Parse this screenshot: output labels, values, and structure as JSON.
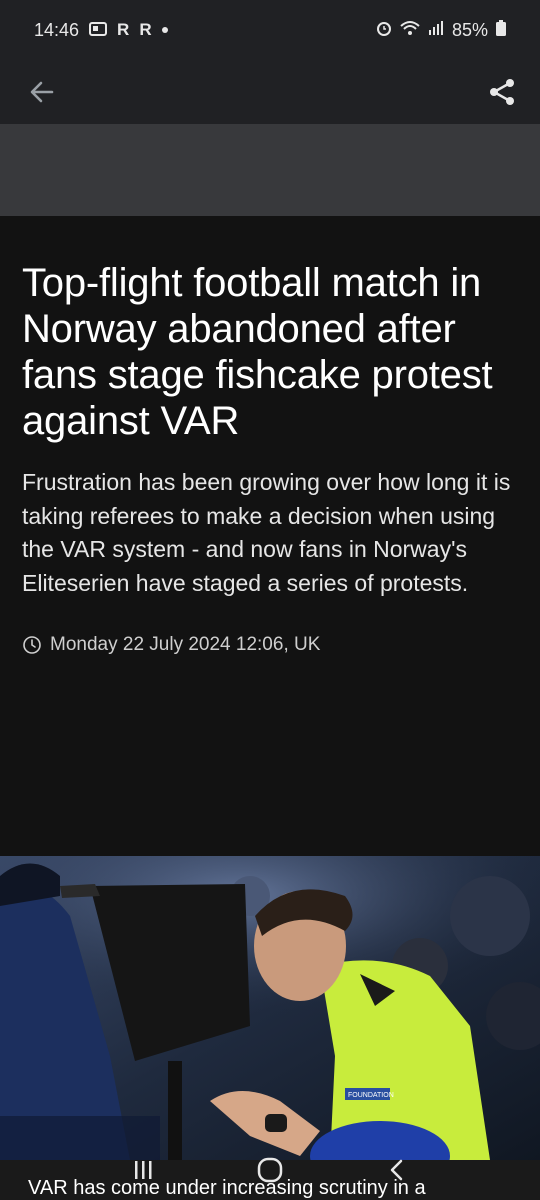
{
  "status": {
    "time": "14:46",
    "notif_icons": [
      "R",
      "R"
    ],
    "battery": "85%"
  },
  "app_bar": {
    "back_icon": "arrow-left-icon",
    "share_icon": "share-icon"
  },
  "article": {
    "headline": "Top-flight football match in Norway abandoned after fans stage fishcake protest against VAR",
    "standfirst": "Frustration has been growing over how long it is taking referees to make a decision when using the VAR system - and now fans in Norway's Eliteserien have staged a series of protests.",
    "date": "Monday 22 July 2024 12:06, UK",
    "image_caption_partial": "VAR has come under increasing scrutiny in a"
  },
  "image": {
    "badge_text": "FOUNDATION"
  },
  "colors": {
    "header_bg": "#121212",
    "bar_bg": "#202124",
    "ad_bg": "#38393c",
    "referee_shirt": "#c8ec3c"
  }
}
